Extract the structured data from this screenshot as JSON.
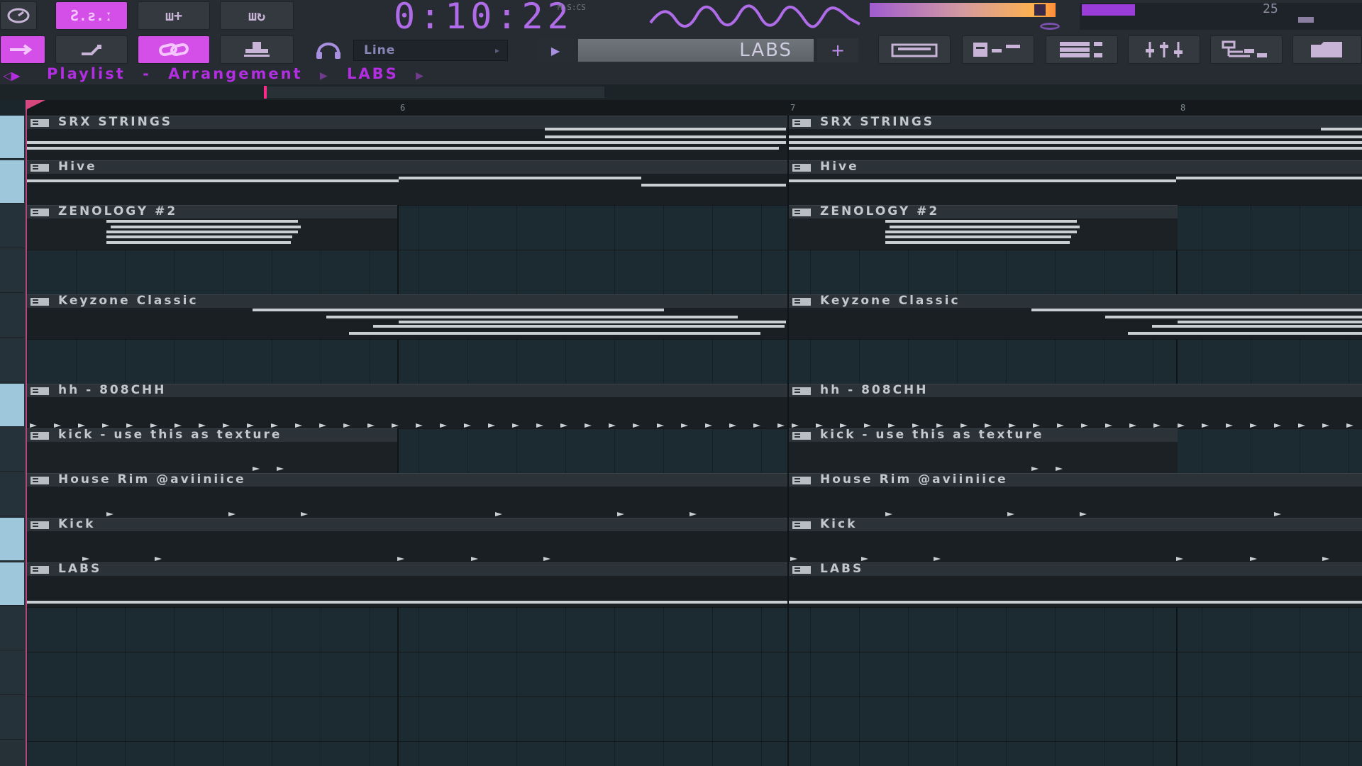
{
  "window": {
    "title": "Playlist - Arrangement"
  },
  "toolbar": {
    "time_value": "0:10:22",
    "time_format": "M:S:CS",
    "pattern_name": "LABS",
    "snap_mode": "Line",
    "tempo_value": "25",
    "colors": {
      "accent": "#d44fe7",
      "time": "#b06ce8",
      "breadcrumb": "#b22ee0"
    },
    "buttons": {
      "pat_song_label": "Ƨ.ƨ.ː",
      "step_edit_label": "ш+",
      "loop_label": "ш↻"
    },
    "icons": [
      "metronome-icon",
      "step-edit-icon",
      "loop-record-icon",
      "slide-icon",
      "link-icon",
      "stamp-icon",
      "headphones-icon",
      "play-icon",
      "add-icon",
      "piano-roll-icon",
      "channel-rack-icon",
      "playlist-icon",
      "mixer-icon",
      "browser-icon",
      "folder-icon"
    ]
  },
  "breadcrumb": {
    "items": [
      "Playlist",
      "Arrangement",
      "LABS"
    ],
    "dash": "-"
  },
  "ruler": {
    "bars": [
      "6",
      "7",
      "8"
    ]
  },
  "tracks": [
    {
      "name": "SRX STRINGS",
      "selected": true
    },
    {
      "name": "Hive",
      "selected": true
    },
    {
      "name": "ZENOLOGY #2",
      "selected": false
    },
    {
      "name": "Keyzone Classic",
      "selected": false
    },
    {
      "name": "hh - 808CHH",
      "selected": true
    },
    {
      "name": "kick - use this as texture",
      "selected": false
    },
    {
      "name": "House Rim @aviiniice",
      "selected": false
    },
    {
      "name": "Kick",
      "selected": true
    },
    {
      "name": "LABS",
      "selected": true
    }
  ],
  "clips": {
    "c1": "SRX STRINGS",
    "c2": "Hive",
    "c3": "ZENOLOGY #2",
    "c4": "Keyzone Classic",
    "c5": "hh - 808CHH",
    "c6": "kick - use this as texture",
    "c7": "House Rim @aviiniice",
    "c8": "Kick",
    "c9": "LABS"
  }
}
